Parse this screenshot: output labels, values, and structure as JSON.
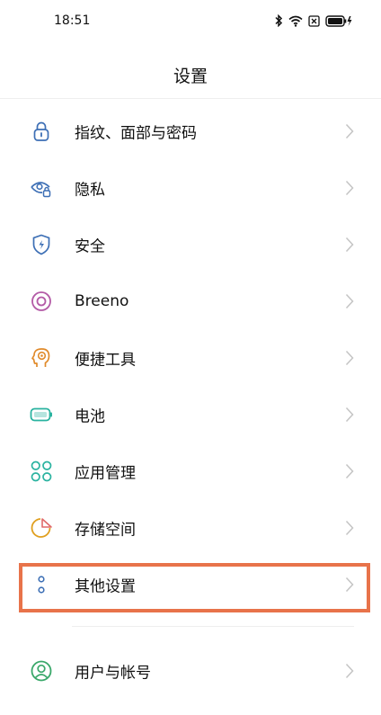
{
  "status": {
    "time": "18:51",
    "icons": [
      "bluetooth-icon",
      "wifi-icon",
      "sim-icon",
      "battery-charging-icon"
    ]
  },
  "header": {
    "title": "设置"
  },
  "items": [
    {
      "label": "指纹、面部与密码",
      "icon": "lock-icon",
      "color": "#3d6fb5"
    },
    {
      "label": "隐私",
      "icon": "privacy-eye-icon",
      "color": "#3d6fb5"
    },
    {
      "label": "安全",
      "icon": "shield-icon",
      "color": "#3d6fb5"
    },
    {
      "label": "Breeno",
      "icon": "breeno-icon",
      "color": "#b35aa6"
    },
    {
      "label": "便捷工具",
      "icon": "head-tools-icon",
      "color": "#e08a2a"
    },
    {
      "label": "电池",
      "icon": "battery-icon",
      "color": "#2ab3a0"
    },
    {
      "label": "应用管理",
      "icon": "apps-grid-icon",
      "color": "#2ab3a0"
    },
    {
      "label": "存储空间",
      "icon": "storage-pie-icon",
      "color": "#e0a020"
    },
    {
      "label": "其他设置",
      "icon": "more-settings-icon",
      "color": "#3d6fb5"
    },
    {
      "label": "用户与帐号",
      "icon": "user-icon",
      "color": "#3aa86a"
    }
  ]
}
